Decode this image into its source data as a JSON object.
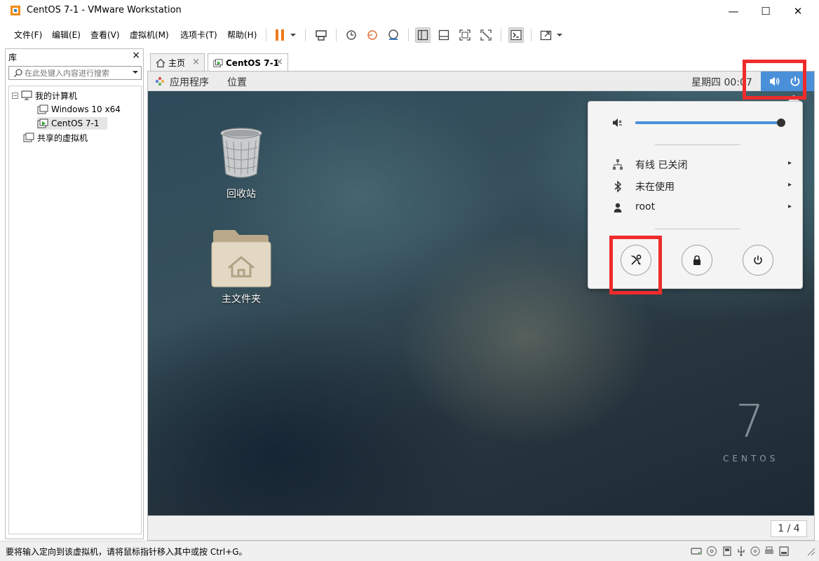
{
  "window": {
    "title": "CentOS 7-1 - VMware Workstation",
    "minimize": "—",
    "maximize": "☐",
    "close": "✕"
  },
  "menu": [
    "文件(F)",
    "编辑(E)",
    "查看(V)",
    "虚拟机(M)",
    "选项卡(T)",
    "帮助(H)"
  ],
  "library": {
    "title": "库",
    "close": "×",
    "search_placeholder": "在此处键入内容进行搜索",
    "tree": {
      "my_computer": "我的计算机",
      "vm1": "Windows 10 x64",
      "vm2": "CentOS 7-1",
      "shared": "共享的虚拟机"
    }
  },
  "tabs": [
    {
      "label": "主页",
      "close": "×"
    },
    {
      "label": "CentOS 7-1",
      "close": "×"
    }
  ],
  "guest": {
    "top_bar": {
      "applications": "应用程序",
      "places": "位置",
      "clock": "星期四 00:07"
    },
    "desktop": {
      "trash_label": "回收站",
      "home_label": "主文件夹",
      "brand_number": "7",
      "brand_word": "CENTOS"
    },
    "system_menu": {
      "volume_level": 1.0,
      "wired": "有线 已关闭",
      "bluetooth": "未在使用",
      "user": "root",
      "arrow": "▸"
    },
    "workspace_indicator": "1 / 4"
  },
  "statusbar": {
    "message": "要将输入定向到该虚拟机，请将鼠标指针移入其中或按 Ctrl+G。"
  },
  "colors": {
    "highlight_box": "#ef2b2b",
    "gnome_accent": "#4a90d9",
    "pause_icon": "#f07a1a"
  }
}
